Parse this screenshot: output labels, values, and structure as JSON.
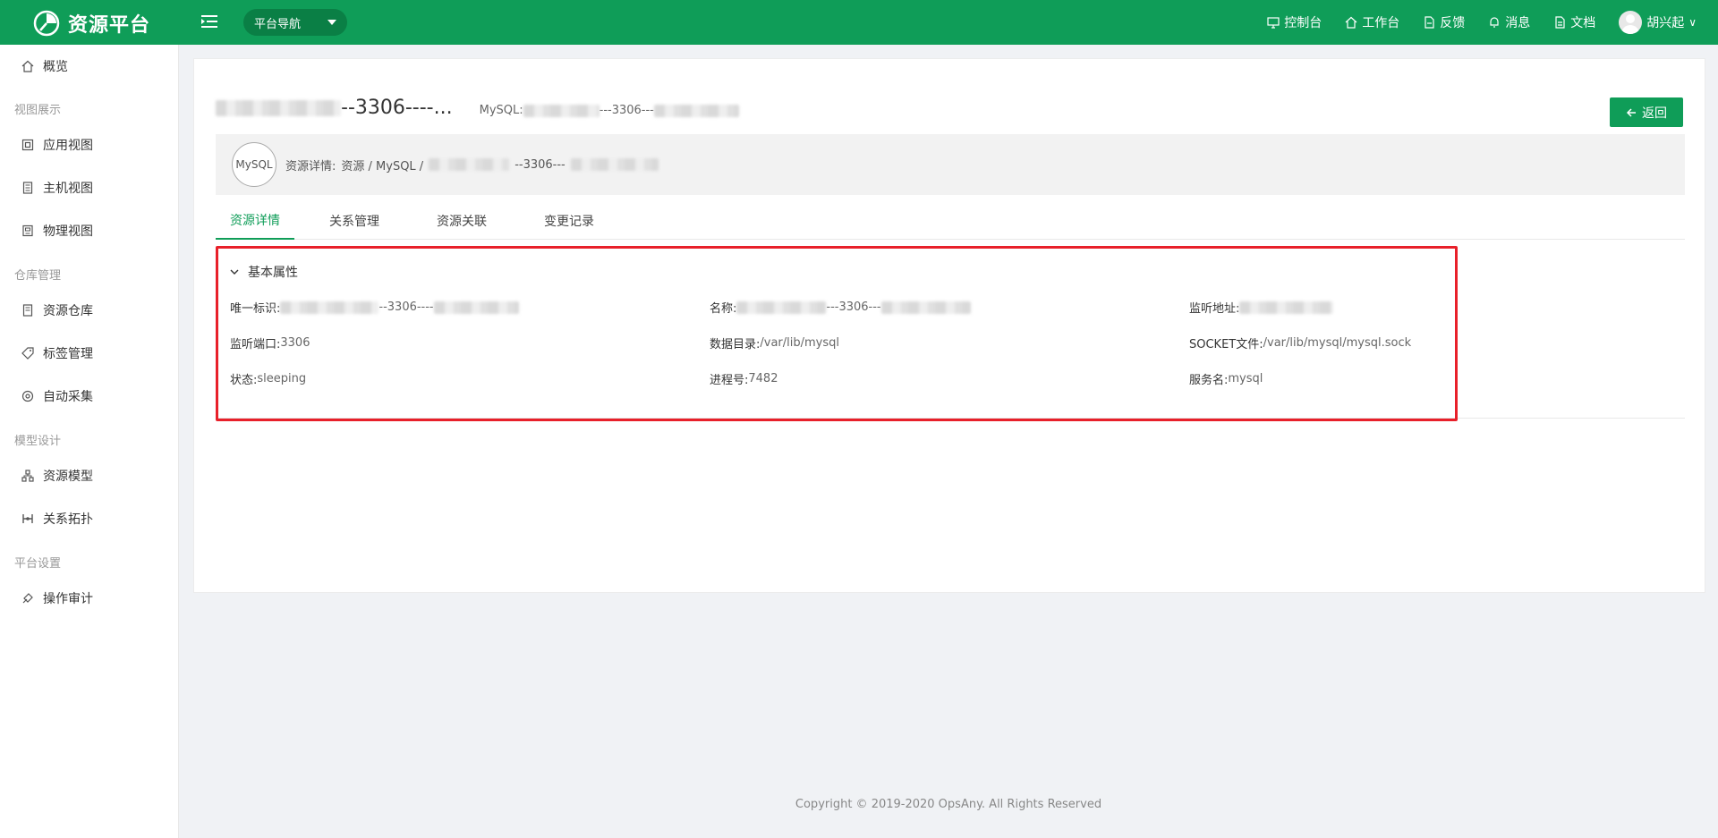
{
  "app": {
    "title": "资源平台"
  },
  "header": {
    "platform_nav": "平台导航",
    "items": [
      {
        "label": "控制台",
        "icon": "monitor-icon"
      },
      {
        "label": "工作台",
        "icon": "home-icon"
      },
      {
        "label": "反馈",
        "icon": "file-icon"
      },
      {
        "label": "消息",
        "icon": "bell-icon"
      },
      {
        "label": "文档",
        "icon": "doc-icon"
      }
    ],
    "user": "胡兴起",
    "accent": "#0f9d58"
  },
  "sidebar": {
    "overview": "概览",
    "groups": [
      {
        "title": "视图展示",
        "items": [
          "应用视图",
          "主机视图",
          "物理视图"
        ]
      },
      {
        "title": "仓库管理",
        "items": [
          "资源仓库",
          "标签管理",
          "自动采集"
        ]
      },
      {
        "title": "模型设计",
        "items": [
          "资源模型",
          "关系拓扑"
        ]
      },
      {
        "title": "平台设置",
        "items": [
          "操作审计"
        ]
      }
    ]
  },
  "page": {
    "title_suffix": "--3306----...",
    "subtitle_prefix": "MySQL:",
    "subtitle_mid": "---3306---",
    "back_label": "返回",
    "badge": "MySQL",
    "crumb_label": "资源详情:",
    "crumb_path": "资源 / MySQL /",
    "crumb_mid": "--3306---",
    "tabs": [
      "资源详情",
      "关系管理",
      "资源关联",
      "变更记录"
    ],
    "section_title": "基本属性",
    "props": {
      "uid_label": "唯一标识:",
      "uid_mid": "--3306----",
      "name_label": "名称:",
      "name_mid": "---3306---",
      "listen_addr_label": "监听地址:",
      "port_label": "监听端口:",
      "port_value": "3306",
      "datadir_label": "数据目录:",
      "datadir_value": "/var/lib/mysql",
      "socket_label": "SOCKET文件:",
      "socket_value": "/var/lib/mysql/mysql.sock",
      "status_label": "状态:",
      "status_value": "sleeping",
      "pid_label": "进程号:",
      "pid_value": "7482",
      "service_label": "服务名:",
      "service_value": "mysql"
    }
  },
  "footer": "Copyright © 2019-2020 OpsAny. All Rights Reserved"
}
